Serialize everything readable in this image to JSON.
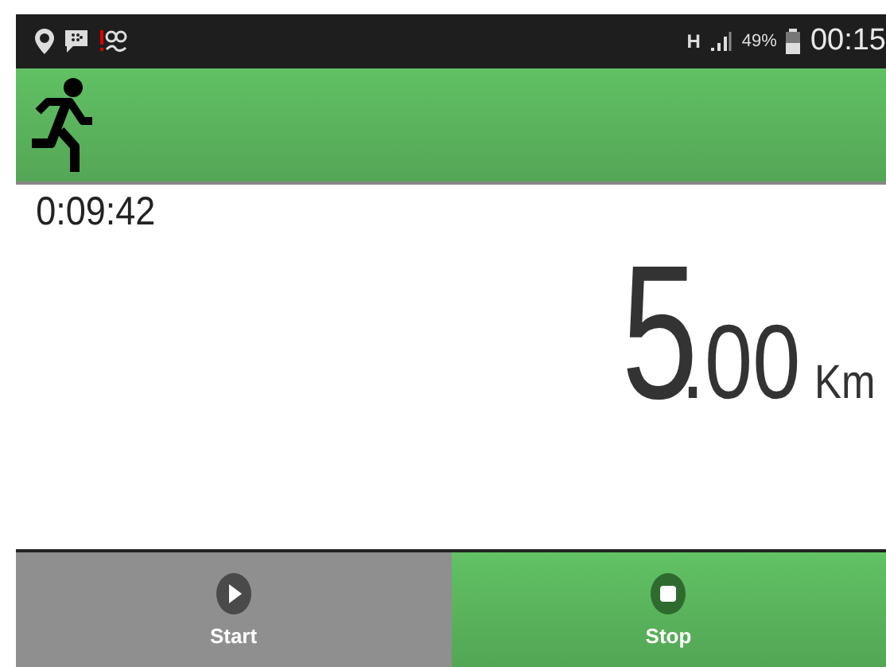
{
  "status_bar": {
    "network": "H",
    "battery": "49%",
    "time": "00:15"
  },
  "timer": "0:09:42",
  "distance": {
    "whole": "5",
    "decimals": ".00",
    "unit": "Km"
  },
  "buttons": [
    {
      "label": "Start",
      "kind": "play",
      "active": false
    },
    {
      "label": "Stop",
      "kind": "stop",
      "active": true
    }
  ]
}
